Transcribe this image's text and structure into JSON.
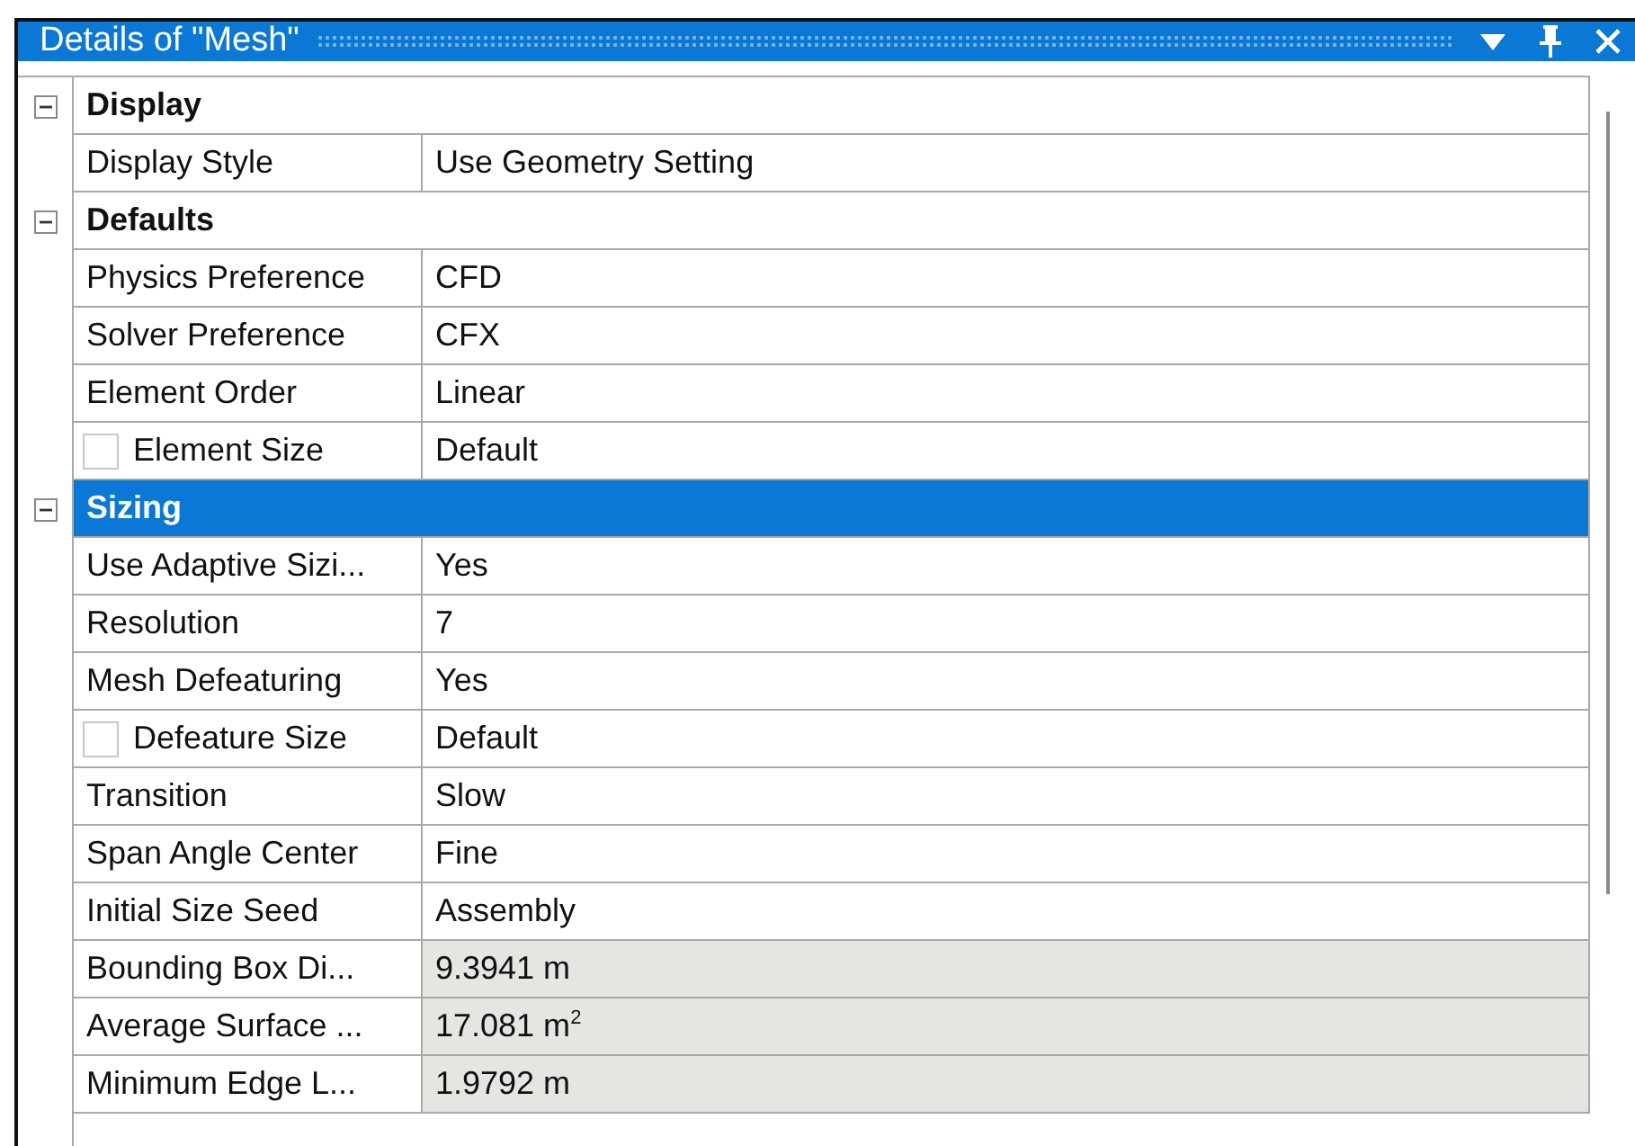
{
  "panel": {
    "title": "Details of \"Mesh\""
  },
  "sections": [
    {
      "title": "Display",
      "expanded": true,
      "selected": false,
      "properties": [
        {
          "kind": "plain",
          "label": "Display Style",
          "value": "Use Geometry Setting",
          "readonly": false
        }
      ]
    },
    {
      "title": "Defaults",
      "expanded": true,
      "selected": false,
      "properties": [
        {
          "kind": "plain",
          "label": "Physics Preference",
          "value": "CFD",
          "readonly": false
        },
        {
          "kind": "plain",
          "label": "Solver Preference",
          "value": "CFX",
          "readonly": false
        },
        {
          "kind": "plain",
          "label": "Element Order",
          "value": "Linear",
          "readonly": false
        },
        {
          "kind": "optional",
          "checked": false,
          "label": "Element Size",
          "value": "Default",
          "readonly": false
        }
      ]
    },
    {
      "title": "Sizing",
      "expanded": true,
      "selected": true,
      "properties": [
        {
          "kind": "plain",
          "label": "Use Adaptive Sizi...",
          "value": "Yes",
          "readonly": false
        },
        {
          "kind": "plain",
          "label": "Resolution",
          "value": "7",
          "readonly": false
        },
        {
          "kind": "plain",
          "label": "Mesh Defeaturing",
          "value": "Yes",
          "readonly": false
        },
        {
          "kind": "optional",
          "checked": false,
          "label": "Defeature Size",
          "value": "Default",
          "readonly": false
        },
        {
          "kind": "plain",
          "label": "Transition",
          "value": "Slow",
          "readonly": false
        },
        {
          "kind": "plain",
          "label": "Span Angle Center",
          "value": "Fine",
          "readonly": false
        },
        {
          "kind": "plain",
          "label": "Initial Size Seed",
          "value": "Assembly",
          "readonly": false
        },
        {
          "kind": "plain",
          "label": "Bounding Box Di...",
          "value": "9.3941 m",
          "readonly": true
        },
        {
          "kind": "plain",
          "label": "Average Surface ...",
          "value": "17.081 m$^{2}$",
          "readonly": true
        },
        {
          "kind": "plain",
          "label": "Minimum Edge L...",
          "value": "1.9792 m",
          "readonly": true
        }
      ]
    }
  ]
}
